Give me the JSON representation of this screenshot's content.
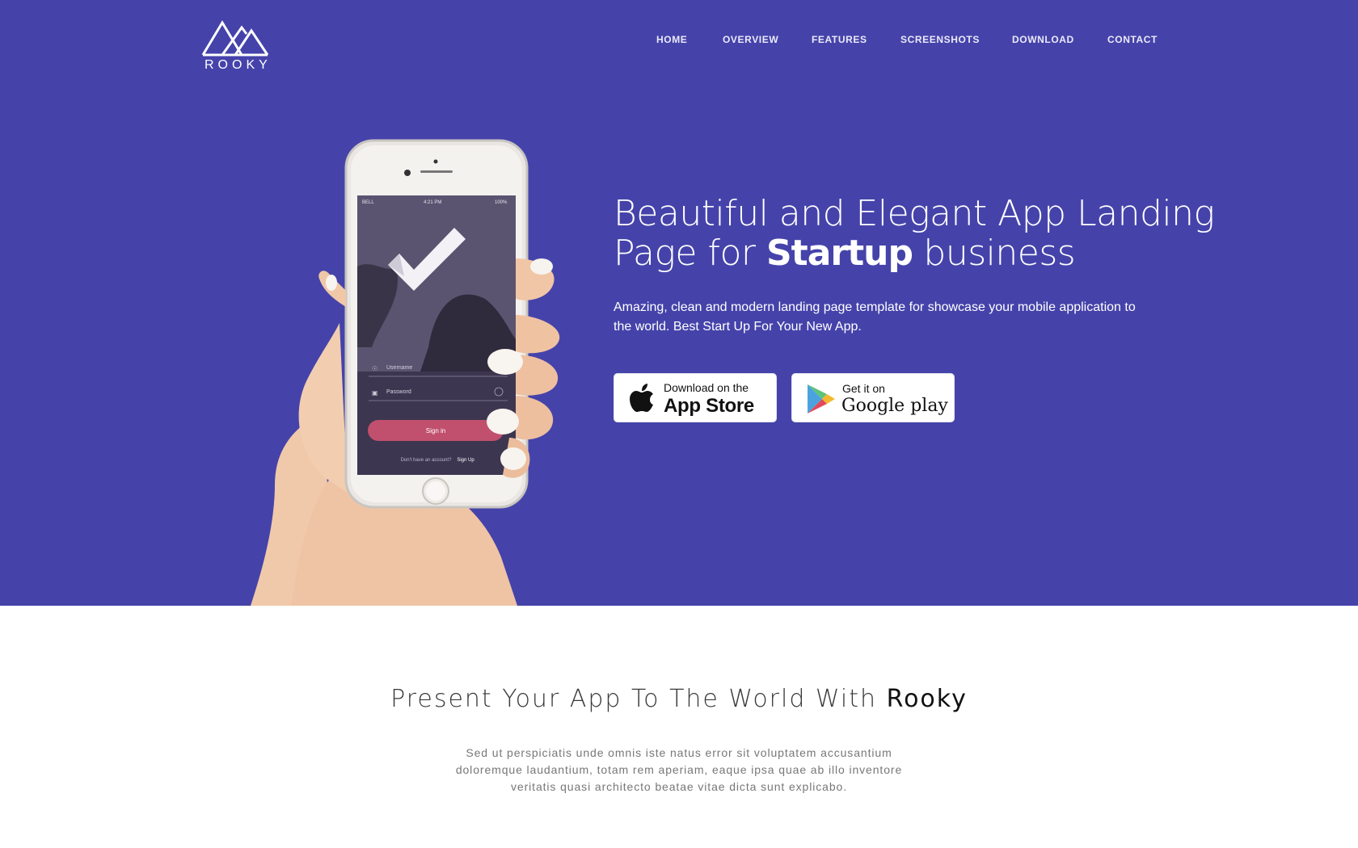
{
  "brand": {
    "name": "ROOKY"
  },
  "nav": {
    "items": [
      {
        "id": "home",
        "label": "HOME"
      },
      {
        "id": "overview",
        "label": "OVERVIEW"
      },
      {
        "id": "features",
        "label": "FEATURES"
      },
      {
        "id": "screenshots",
        "label": "SCREENSHOTS"
      },
      {
        "id": "download",
        "label": "DOWNLOAD"
      },
      {
        "id": "contact",
        "label": "CONTACT"
      }
    ]
  },
  "hero": {
    "headline_line1": "Beautiful and Elegant App Landing",
    "headline_prefix": "Page for ",
    "headline_strong": "Startup",
    "headline_suffix": " business",
    "subtitle": "Amazing, clean and modern landing page template for showcase your mobile application to the world. Best Start Up For Your New App."
  },
  "buttons": {
    "appstore": {
      "small": "Download on the",
      "big": "App Store"
    },
    "googleplay": {
      "small": "Get it on",
      "big": "Google play"
    }
  },
  "phone": {
    "carrier": "BELL",
    "time": "4:21 PM",
    "battery": "100%",
    "username_placeholder": "Username",
    "password_placeholder": "Password",
    "signin": "Sign in",
    "signup_prompt": "Don't have an account?",
    "signup_link": "Sign Up"
  },
  "section2": {
    "title_prefix": "Present Your App To The World With ",
    "title_strong": "Rooky",
    "description": "Sed ut perspiciatis unde omnis iste natus error sit voluptatem accusantium doloremque laudantium, totam rem aperiam, eaque ipsa quae ab illo inventore veritatis quasi architecto beatae vitae dicta sunt explicabo."
  },
  "colors": {
    "hero_bg": "#4543aa",
    "signin_button": "#c0506d",
    "screen_bg": "#5a5470"
  }
}
